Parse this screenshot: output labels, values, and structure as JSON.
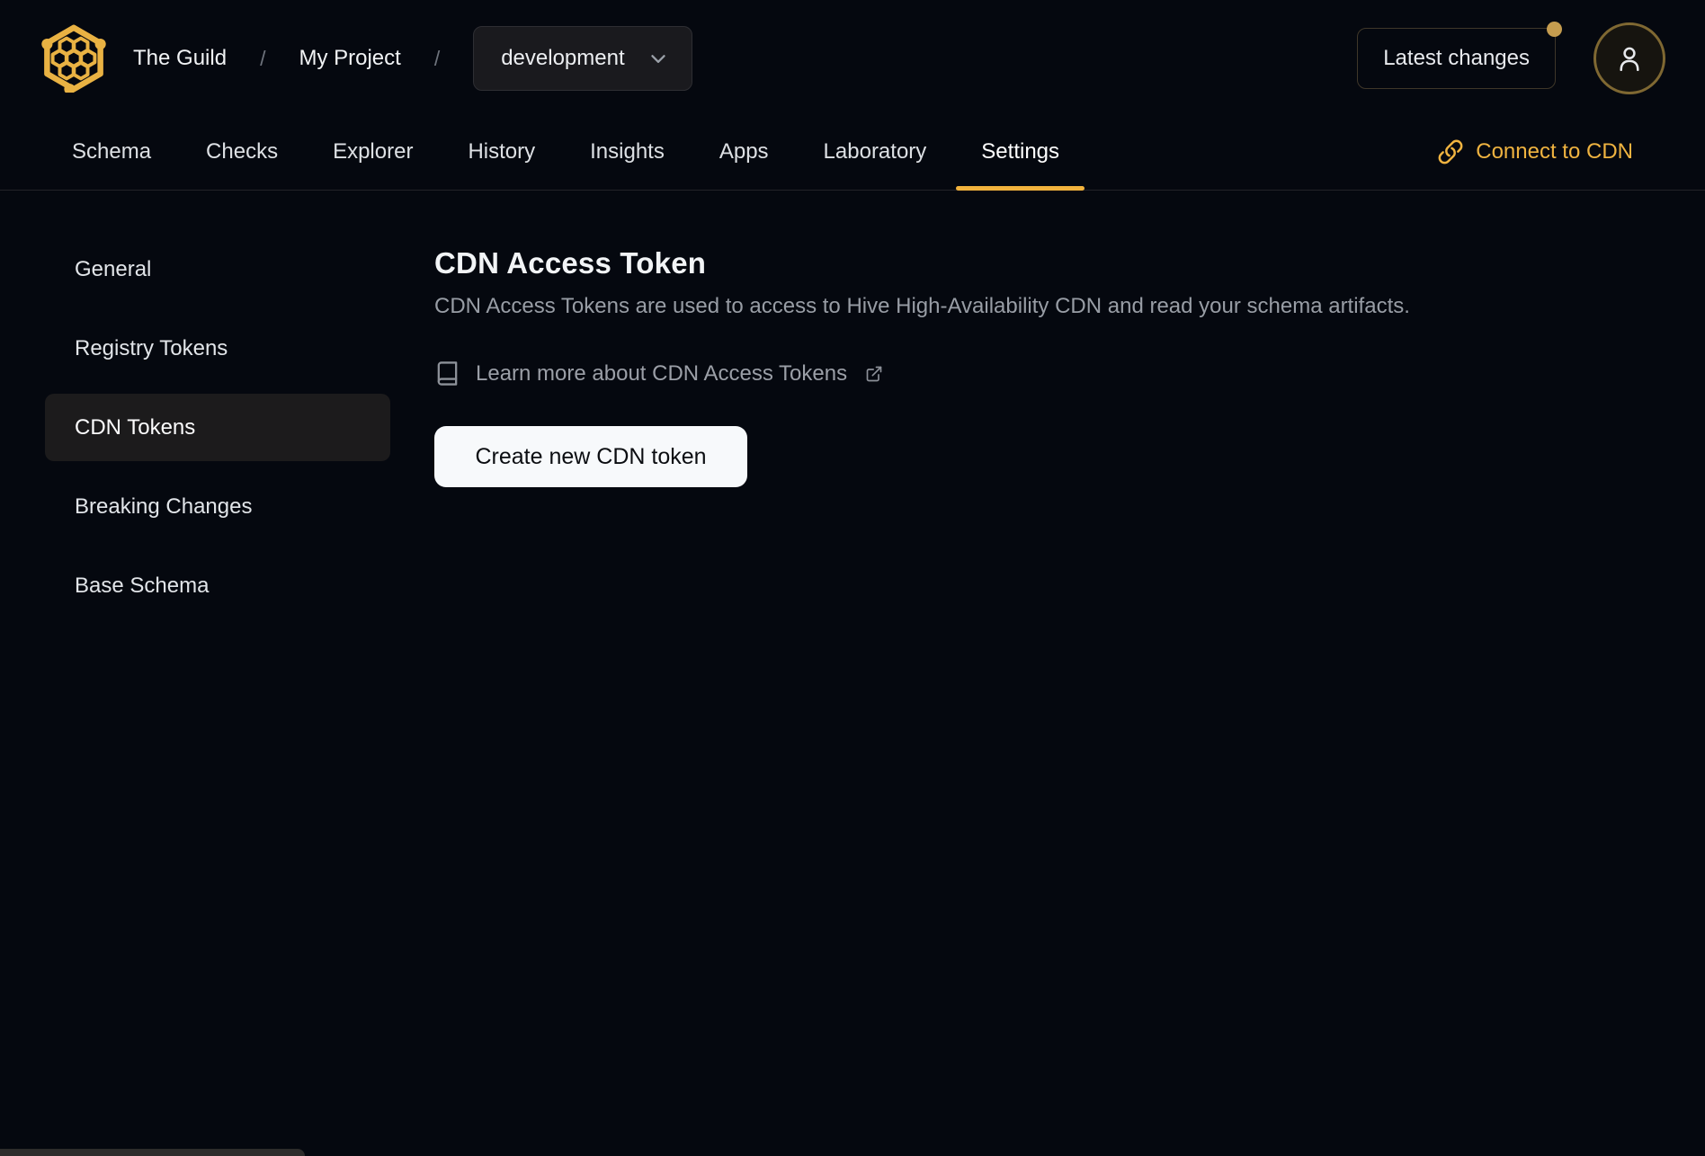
{
  "theme": {
    "background": "#05080f",
    "accent_yellow": "#f2b33d",
    "notification_dot": "#c59c4f",
    "active_item_bg": "#1c1b1c",
    "muted_text": "#989da5",
    "primary_button_bg": "#f7f9fb",
    "primary_button_text": "#0b0d11"
  },
  "header": {
    "logo_icon": "hive-honeycomb-logo",
    "breadcrumb": {
      "organization": "The Guild",
      "separator": "/",
      "project": "My Project"
    },
    "target_select": {
      "value": "development",
      "chevron_icon": "chevron-down-icon"
    },
    "latest_changes_button": "Latest changes",
    "avatar_icon": "user-icon"
  },
  "tabs": {
    "items": [
      {
        "label": "Schema",
        "active": false
      },
      {
        "label": "Checks",
        "active": false
      },
      {
        "label": "Explorer",
        "active": false
      },
      {
        "label": "History",
        "active": false
      },
      {
        "label": "Insights",
        "active": false
      },
      {
        "label": "Apps",
        "active": false
      },
      {
        "label": "Laboratory",
        "active": false
      },
      {
        "label": "Settings",
        "active": true
      }
    ],
    "connect_to_cdn": {
      "label": "Connect to CDN",
      "icon": "link-icon"
    }
  },
  "sidebar": {
    "items": [
      {
        "label": "General",
        "active": false
      },
      {
        "label": "Registry Tokens",
        "active": false
      },
      {
        "label": "CDN Tokens",
        "active": true
      },
      {
        "label": "Breaking Changes",
        "active": false
      },
      {
        "label": "Base Schema",
        "active": false
      }
    ]
  },
  "main": {
    "title": "CDN Access Token",
    "description": "CDN Access Tokens are used to access to Hive High-Availability CDN and read your schema artifacts.",
    "learn_more": {
      "label": "Learn more about CDN Access Tokens",
      "book_icon": "book-icon",
      "external_icon": "external-link-icon"
    },
    "create_button": "Create new CDN token"
  }
}
